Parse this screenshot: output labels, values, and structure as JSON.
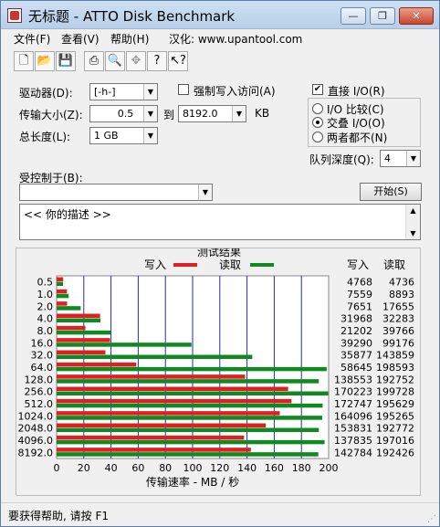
{
  "window": {
    "title": "无标题 - ATTO Disk Benchmark",
    "controls": [
      "—",
      "❐",
      "✕"
    ]
  },
  "menu": [
    "文件(F)",
    "查看(V)",
    "帮助(H)",
    "汉化: www.upantool.com"
  ],
  "toolbar": {
    "icons": [
      "new-icon",
      "open-icon",
      "save-icon",
      "print-icon",
      "print-preview-icon",
      "move-icon",
      "help-icon",
      "context-help-icon"
    ]
  },
  "settings": {
    "drive_label": "驱动器(D):",
    "drive_value": "[-h-]",
    "force_write_label": "强制写入访问(A)",
    "transfer_size_label": "传输大小(Z):",
    "transfer_from": "0.5",
    "transfer_to_label": "到",
    "transfer_to": "8192.0",
    "transfer_unit": "KB",
    "total_length_label": "总长度(L):",
    "total_length_value": "1 GB",
    "direct_io_label": "直接 I/O(R)",
    "io_compare_label": "I/O 比较(C)",
    "overlapped_io_label": "交叠 I/O(O)",
    "neither_label": "两者都不(N)",
    "queue_depth_label": "队列深度(Q):",
    "queue_depth_value": "4",
    "controlled_by_label": "受控制于(B):",
    "controlled_by_value": "",
    "start_label": "开始(S)",
    "description": "<<  你的描述    >>"
  },
  "status": {
    "text": "要获得帮助, 请按 F1"
  },
  "colors": {
    "write": "#e02020",
    "read": "#108a20",
    "gridline": "#2a2aa0"
  },
  "chart_data": {
    "type": "bar",
    "orientation": "horizontal",
    "title": "测试结果",
    "legend_position": "top",
    "write_column_label": "写入",
    "read_column_label": "读取",
    "xlabel": "传输速率 - MB / 秒",
    "xlim": [
      0,
      200
    ],
    "xticks": [
      0,
      20,
      40,
      60,
      80,
      100,
      120,
      140,
      160,
      180,
      200
    ],
    "categories": [
      "0.5",
      "1.0",
      "2.0",
      "4.0",
      "8.0",
      "16.0",
      "32.0",
      "64.0",
      "128.0",
      "256.0",
      "512.0",
      "1024.0",
      "2048.0",
      "4096.0",
      "8192.0"
    ],
    "series": [
      {
        "name": "写入",
        "values": [
          4.8,
          7.6,
          7.7,
          32.0,
          21.2,
          39.3,
          35.9,
          58.6,
          138.6,
          170.2,
          172.7,
          164.1,
          153.8,
          137.8,
          142.8
        ]
      },
      {
        "name": "读取",
        "values": [
          4.7,
          8.9,
          17.7,
          32.3,
          39.8,
          99.2,
          143.9,
          198.6,
          192.8,
          199.7,
          195.6,
          195.3,
          192.8,
          197.0,
          192.4
        ]
      }
    ],
    "write_table": [
      "4768",
      "7559",
      "7651",
      "31968",
      "21202",
      "39290",
      "35877",
      "58645",
      "138553",
      "170223",
      "172747",
      "164096",
      "153831",
      "137835",
      "142784"
    ],
    "read_table": [
      "4736",
      "8893",
      "17655",
      "32283",
      "39766",
      "99176",
      "143859",
      "198593",
      "192752",
      "199728",
      "195629",
      "195265",
      "192772",
      "197016",
      "192426"
    ]
  }
}
